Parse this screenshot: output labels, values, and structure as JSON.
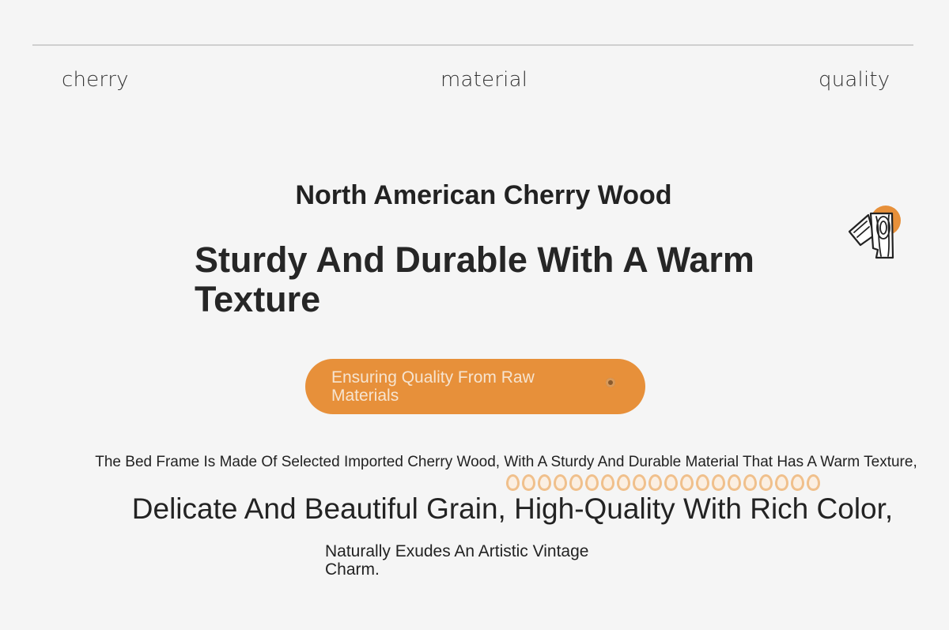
{
  "keywords": {
    "left": "cherry",
    "center": "material",
    "right": "quality"
  },
  "hero": {
    "subtitle": "North American Cherry Wood",
    "headline": "Sturdy And Durable With A Warm Texture"
  },
  "cta": {
    "label": "Ensuring Quality From Raw Materials"
  },
  "description": {
    "line1": "The Bed Frame Is Made Of Selected Imported Cherry Wood, With A Sturdy And Durable Material That Has A Warm Texture,",
    "line2": "Delicate And Beautiful Grain, High-Quality With Rich Color,",
    "line3": "Naturally Exudes An Artistic Vintage Charm."
  },
  "icons": {
    "wood": "wood-grain-icon",
    "beads": "bead-chain-icon"
  },
  "colors": {
    "accent": "#e7903a",
    "background": "#f5f5f5",
    "text": "#222222",
    "bead": "#f0c08c"
  }
}
